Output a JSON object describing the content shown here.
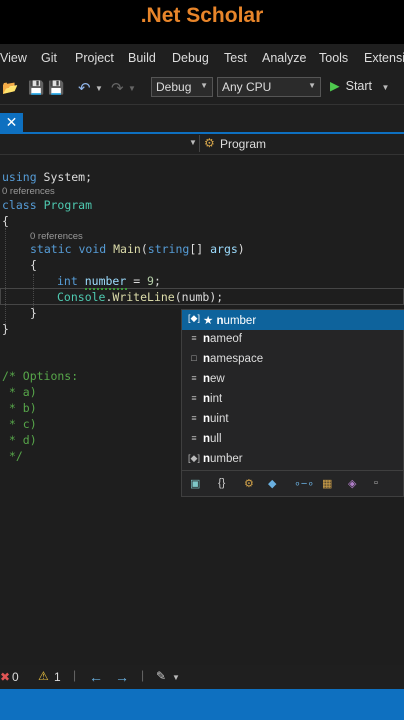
{
  "banner": {
    "title": ".Net Scholar"
  },
  "menu": [
    "View",
    "Git",
    "Project",
    "Build",
    "Debug",
    "Test",
    "Analyze",
    "Tools",
    "Extensic"
  ],
  "toolbar": {
    "config": "Debug",
    "platform": "Any CPU",
    "start": "Start"
  },
  "navbar": {
    "member": "Program"
  },
  "code": {
    "l1_kw": "using",
    "l1_rest": " System;",
    "refs1": "0 references",
    "l2_kw": "class",
    "l2_ty": "Program",
    "brace_open": "{",
    "brace_close": "}",
    "refs2": "0 references",
    "l3_a": "static",
    "l3_b": "void",
    "l3_fn": "Main",
    "l3_c": "(",
    "l3_d": "string",
    "l3_e": "[] ",
    "l3_f": "args",
    "l3_g": ")",
    "inner_open": "{",
    "inner_close": "}",
    "l4_kw": "int",
    "l4_var": "number",
    "l4_eq": " = ",
    "l4_num": "9",
    "l4_end": ";",
    "l5_ty": "Console",
    "l5_dot": ".",
    "l5_fn": "WriteLine",
    "l5_rest": "(numb);",
    "c1": "/* Options:",
    "c2": " * a)",
    "c3": " * b)",
    "c4": " * c)",
    "c5": " * d)",
    "c6": " */"
  },
  "autocomplete": {
    "items": [
      {
        "icon": "variable-icon",
        "prefix": "★ ",
        "bold": "n",
        "rest": "umber",
        "selected": true
      },
      {
        "icon": "keyword-icon",
        "prefix": "",
        "bold": "n",
        "rest": "ameof",
        "selected": false
      },
      {
        "icon": "namespace-icon",
        "prefix": "",
        "bold": "n",
        "rest": "amespace",
        "selected": false
      },
      {
        "icon": "keyword-icon",
        "prefix": "",
        "bold": "n",
        "rest": "ew",
        "selected": false
      },
      {
        "icon": "keyword-icon",
        "prefix": "",
        "bold": "n",
        "rest": "int",
        "selected": false
      },
      {
        "icon": "keyword-icon",
        "prefix": "",
        "bold": "n",
        "rest": "uint",
        "selected": false
      },
      {
        "icon": "keyword-icon",
        "prefix": "",
        "bold": "n",
        "rest": "ull",
        "selected": false
      },
      {
        "icon": "variable-icon",
        "prefix": "",
        "bold": "n",
        "rest": "umber",
        "selected": false
      }
    ]
  },
  "status": {
    "errors": "0",
    "warnings": "1"
  }
}
